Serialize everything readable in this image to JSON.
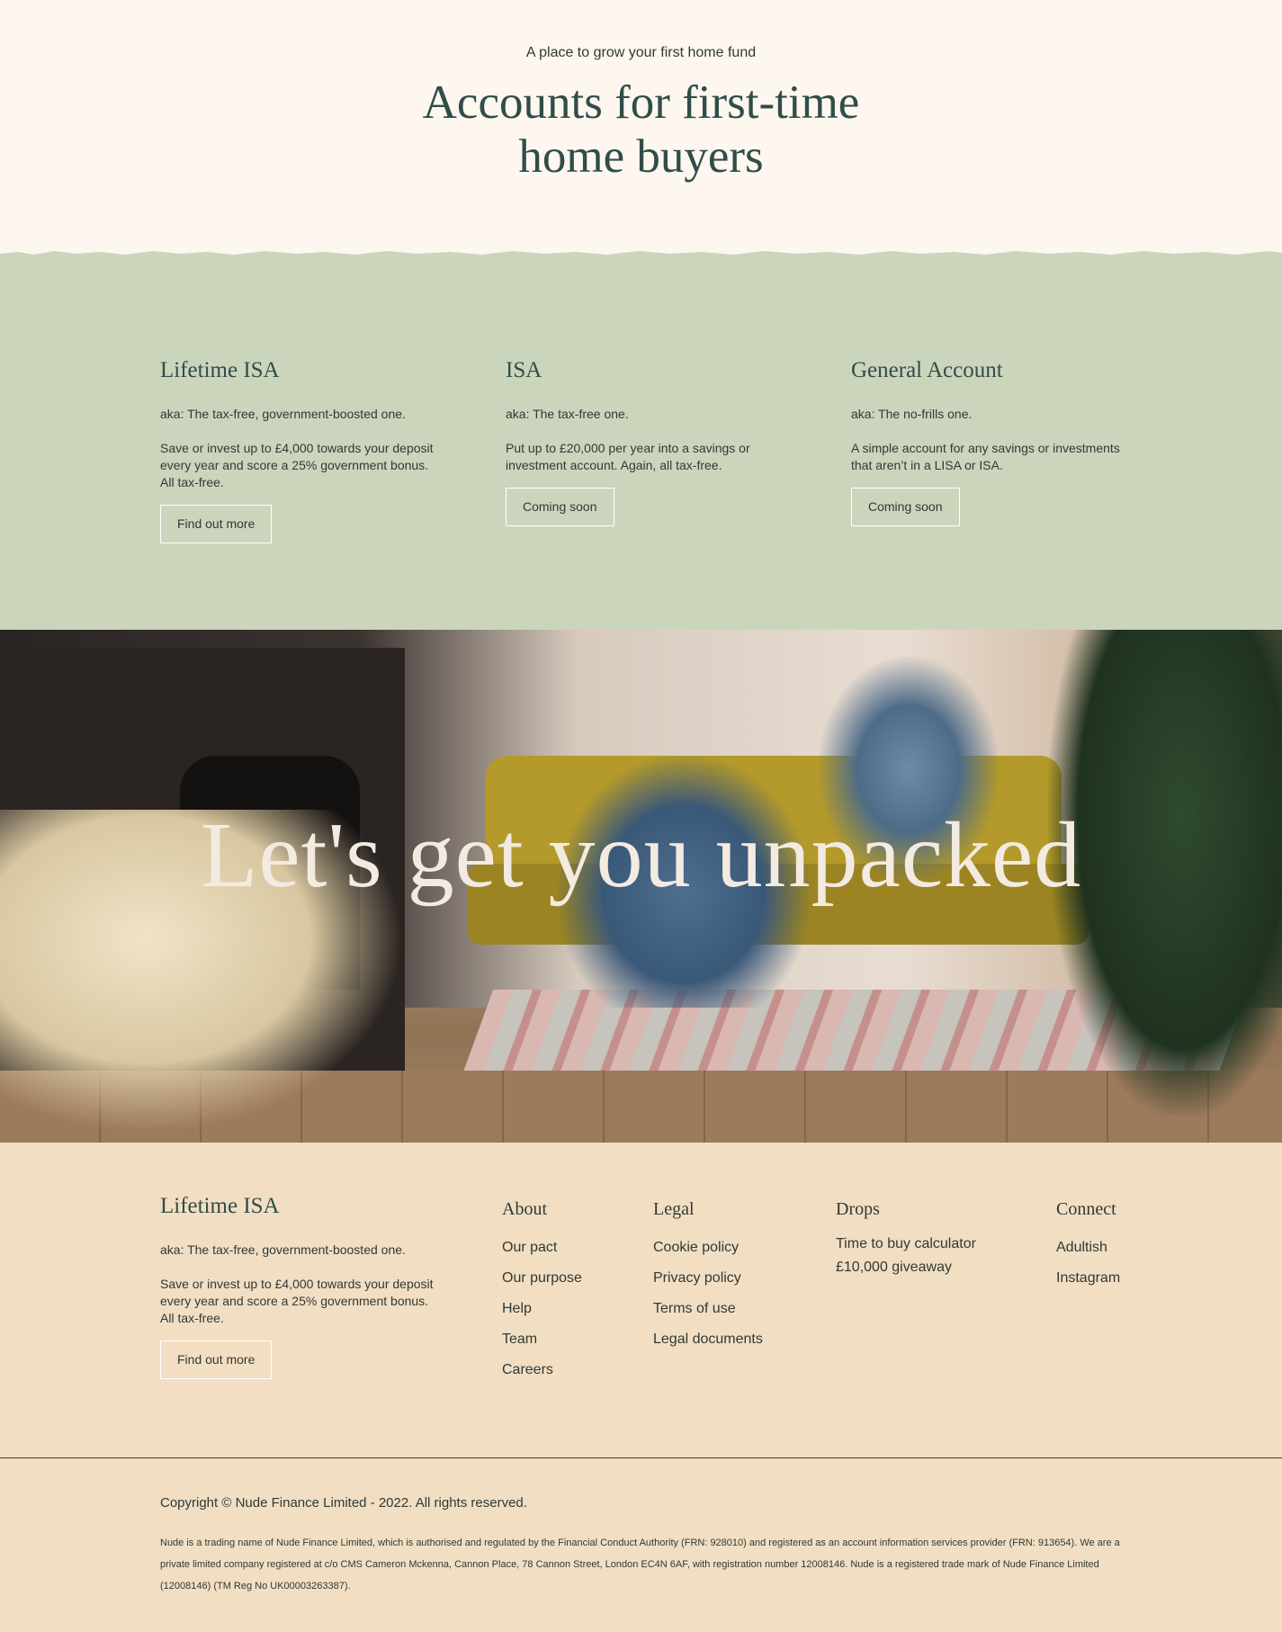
{
  "hero": {
    "kicker": "A place to grow your first home fund",
    "title_line1": "Accounts for first-time",
    "title_line2": "home buyers"
  },
  "accounts": [
    {
      "name": "Lifetime ISA",
      "aka": "aka: The tax-free, government-boosted one.",
      "description": "Save or invest up to £4,000 towards your deposit every year and score a 25% government bonus. All tax-free.",
      "button": "Find out more"
    },
    {
      "name": "ISA",
      "aka": "aka: The tax-free one.",
      "description": "Put up to £20,000 per year into a savings or investment account. Again, all tax-free.",
      "button": "Coming soon"
    },
    {
      "name": "General Account",
      "aka": "aka: The no-frills one.",
      "description": "A simple account for any savings or investments that aren’t in a LISA or ISA.",
      "button": "Coming soon"
    }
  ],
  "banner": {
    "headline": "Let's get you unpacked"
  },
  "footer": {
    "feature": {
      "name": "Lifetime ISA",
      "aka": "aka: The tax-free, government-boosted one.",
      "description": "Save or invest up to £4,000 towards your deposit every year and score a 25% government bonus. All tax-free.",
      "button": "Find out more"
    },
    "columns": {
      "about": {
        "heading": "About",
        "links": [
          "Our pact",
          "Our purpose",
          "Help",
          "Team",
          "Careers"
        ]
      },
      "legal": {
        "heading": "Legal",
        "links": [
          "Cookie policy",
          "Privacy policy",
          "Terms of use",
          "Legal documents"
        ]
      },
      "drops": {
        "heading": "Drops",
        "links": [
          "Time to buy calculator",
          "£10,000 giveaway"
        ]
      },
      "connect": {
        "heading": "Connect",
        "links": [
          "Adultish",
          "Instagram"
        ]
      }
    },
    "copyright": "Copyright © Nude Finance Limited - 2022. All rights reserved.",
    "legal_text": "Nude is a trading name of Nude Finance Limited, which is authorised and regulated by the Financial Conduct Authority (FRN: 928010) and registered as an account information services provider (FRN: 913654). We are a private limited company registered at c/o CMS Cameron Mckenna, Cannon Place, 78 Cannon Street, London EC4N 6AF, with registration number 12008146. Nude is a registered trade mark of Nude Finance Limited (12008146) (TM Reg No UK00003263387)."
  },
  "colors": {
    "cream": "#fdf7f0",
    "sage": "#cbd5bc",
    "sand": "#f2dec3",
    "heading_green": "#304d48",
    "text": "#2f3a36"
  }
}
